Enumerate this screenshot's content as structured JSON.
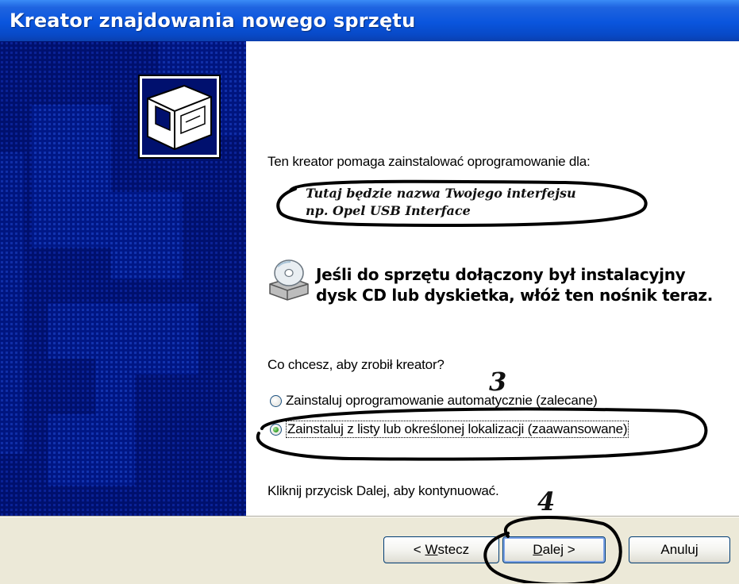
{
  "window": {
    "title": "Kreator znajdowania nowego sprzętu"
  },
  "content": {
    "intro": "Ten kreator pomaga zainstalować oprogramowanie dla:",
    "device_line1": "Tutaj będzie nazwa Twojego interfejsu",
    "device_line2": "np. Opel USB Interface",
    "cd_line1": "Jeśli do sprzętu dołączony był instalacyjny",
    "cd_line2": "dysk CD lub dyskietka, włóż ten nośnik teraz.",
    "question": "Co chcesz, aby zrobił kreator?",
    "options": [
      {
        "label": "Zainstaluj oprogramowanie automatycznie (zalecane)",
        "checked": false
      },
      {
        "label": "Zainstaluj z listy lub określonej lokalizacji (zaawansowane)",
        "checked": true
      }
    ],
    "continue_hint": "Kliknij przycisk Dalej, aby kontynuować."
  },
  "buttons": {
    "back": {
      "prefix": "< ",
      "mnemonic": "W",
      "rest": "stecz"
    },
    "next": {
      "mnemonic": "D",
      "rest": "alej >"
    },
    "cancel": "Anuluj"
  },
  "annotations": {
    "step3": "3",
    "step4": "4"
  },
  "colors": {
    "titlebar": "#0a55dd",
    "sidebar": "#00106e",
    "dialog_bg": "#ece9d8",
    "radio_checked": "#2f9a21"
  },
  "icons": {
    "hardware": "hardware-drawer-icon",
    "cd": "cd-drive-icon"
  }
}
